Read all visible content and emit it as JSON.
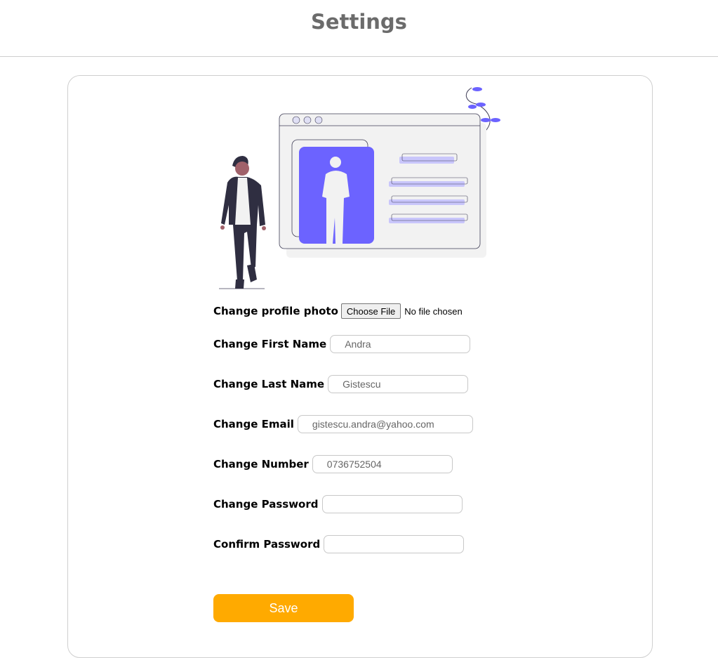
{
  "header": {
    "title": "Settings"
  },
  "form": {
    "photo": {
      "label": "Change profile photo",
      "button_label": "Choose File",
      "status": "No file chosen"
    },
    "first_name": {
      "label": "Change First Name",
      "value": "Andra"
    },
    "last_name": {
      "label": "Change Last Name",
      "value": "Gistescu"
    },
    "email": {
      "label": "Change Email",
      "value": "gistescu.andra@yahoo.com"
    },
    "number": {
      "label": "Change Number",
      "value": "0736752504"
    },
    "password": {
      "label": "Change Password",
      "value": ""
    },
    "confirm_password": {
      "label": "Confirm Password",
      "value": ""
    },
    "save_label": "Save"
  },
  "colors": {
    "accent": "#6c63ff",
    "save_button": "#ffaa00",
    "title_text": "#6b6b6b"
  }
}
